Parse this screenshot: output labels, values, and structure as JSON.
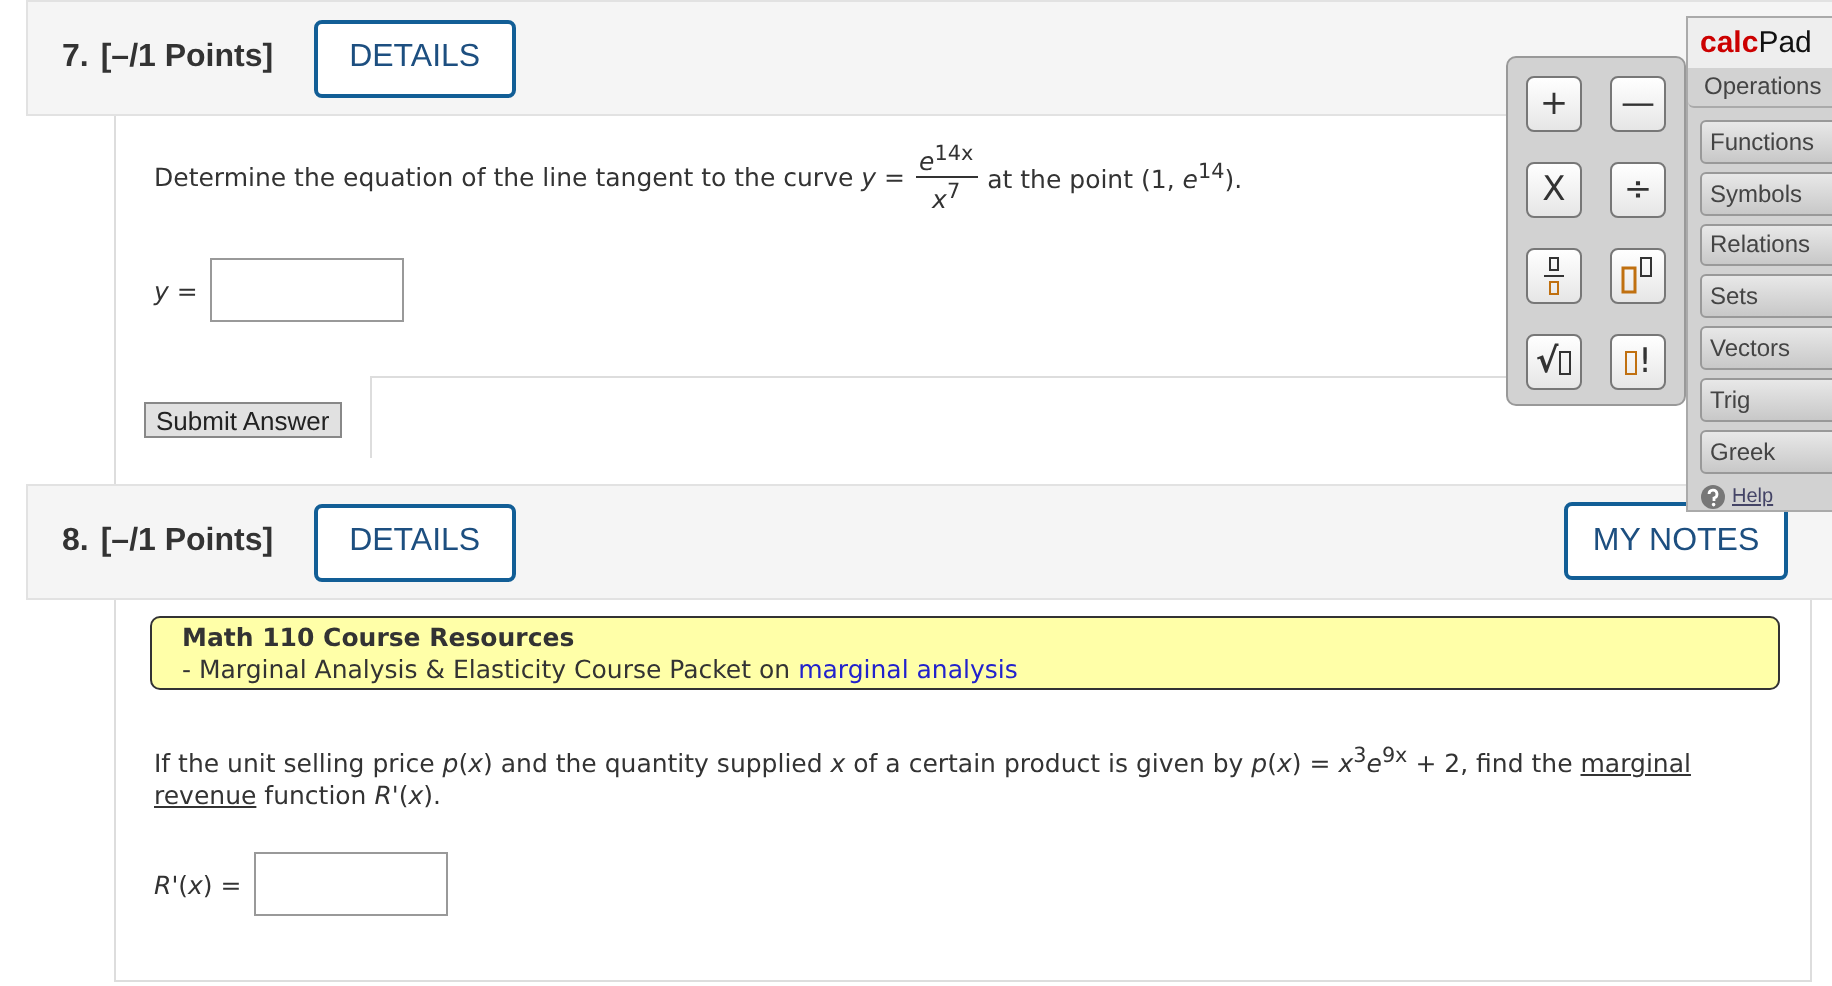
{
  "questions": [
    {
      "number": "7.",
      "points": "[–/1 Points]",
      "details": "DETAILS",
      "kind": "tangent",
      "prompt_before": "Determine the equation of the line tangent to the curve *y* =",
      "numerator": "*e*$^{14x}$",
      "denominator": "*x*$^{7}$",
      "prompt_after": "at the point (1, *e*$^{14}$).",
      "answer_label": "*y* =",
      "submit": "Submit Answer"
    },
    {
      "number": "8.",
      "points": "[–/1 Points]",
      "details": "DETAILS",
      "notes": "MY NOTES",
      "kind": "resource",
      "resource_title": "Math 110 Course Resources",
      "resource_text": "- Marginal Analysis & Elasticity Course Packet on",
      "resource_link": "marginal analysis",
      "prompt_parts": [
        {
          "kind": "text",
          "text": "If the unit selling price *p*(*x*) and the quantity supplied *x* of a certain product is given by *p*(*x*) = *x*$^{3}$*e*$^{9x}$ + 2, find the"
        },
        {
          "kind": "link",
          "text": "marginal"
        },
        {
          "kind": "link",
          "text": "revenue"
        },
        {
          "kind": "text",
          "text": "function *R*'(*x*)."
        }
      ],
      "answer_label": "*R*'(*x*) ="
    }
  ],
  "calcpad": {
    "title_accent": "calc",
    "title": "Pad",
    "keys": [
      {
        "kind": "text",
        "label": "+"
      },
      {
        "kind": "text",
        "label": "—"
      },
      {
        "kind": "text",
        "label": "X"
      },
      {
        "kind": "text",
        "label": "÷"
      },
      {
        "kind": "fraction"
      },
      {
        "kind": "power"
      },
      {
        "kind": "sqrt",
        "label": "√"
      },
      {
        "kind": "factorial",
        "label": "!"
      }
    ],
    "categories": [
      {
        "label": "Operations",
        "selected": true
      },
      {
        "label": "Functions",
        "selected": false
      },
      {
        "label": "Symbols",
        "selected": false
      },
      {
        "label": "Relations",
        "selected": false
      },
      {
        "label": "Sets",
        "selected": false
      },
      {
        "label": "Vectors",
        "selected": false
      },
      {
        "label": "Trig",
        "selected": false
      },
      {
        "label": "Greek",
        "selected": false
      }
    ],
    "help": "Help"
  }
}
